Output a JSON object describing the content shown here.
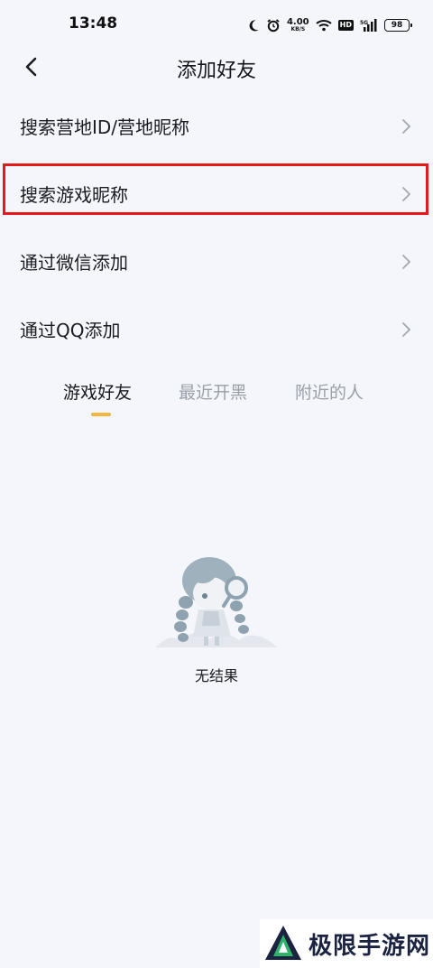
{
  "status_bar": {
    "time": "13:48",
    "net_speed_value": "4.00",
    "net_speed_unit": "KB/S",
    "hd": "HD",
    "signal_label": "5G",
    "battery": "98"
  },
  "header": {
    "title": "添加好友"
  },
  "menu": {
    "items": [
      {
        "label": "搜索营地ID/营地昵称"
      },
      {
        "label": "搜索游戏昵称"
      },
      {
        "label": "通过微信添加"
      },
      {
        "label": "通过QQ添加"
      }
    ]
  },
  "tabs": {
    "items": [
      {
        "label": "游戏好友",
        "active": true
      },
      {
        "label": "最近开黑",
        "active": false
      },
      {
        "label": "附近的人",
        "active": false
      }
    ],
    "indicator_color": "#f5b53f"
  },
  "empty_state": {
    "text": "无结果"
  },
  "watermark": {
    "text": "极限手游网"
  },
  "colors": {
    "background": "#f5f6fb",
    "highlight_border": "#e31a1a"
  }
}
